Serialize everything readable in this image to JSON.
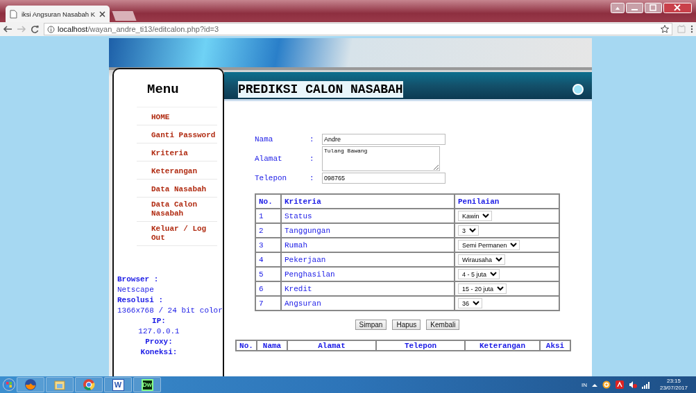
{
  "browser": {
    "tab_title": "iksi Angsuran Nasabah K",
    "url_host": "localhost",
    "url_path": "/wayan_andre_ti13/editcalon.php?id=3"
  },
  "sidebar": {
    "title": "Menu",
    "items": [
      {
        "label": "HOME"
      },
      {
        "label": "Ganti Password"
      },
      {
        "label": "Kriteria"
      },
      {
        "label": "Keterangan"
      },
      {
        "label": "Data Nasabah"
      },
      {
        "label": "Data Calon Nasabah"
      },
      {
        "label": "Keluar / Log Out"
      }
    ],
    "info": [
      {
        "kind": "label",
        "text": "Browser :"
      },
      {
        "kind": "value",
        "text": "Netscape"
      },
      {
        "kind": "label",
        "text": "Resolusi :"
      },
      {
        "kind": "value",
        "text": "1366x768 / 24 bit color"
      },
      {
        "kind": "heading",
        "text": "IP:"
      },
      {
        "kind": "detail",
        "text": "127.0.0.1"
      },
      {
        "kind": "heading",
        "text": "Proxy:"
      },
      {
        "kind": "heading",
        "text": "Koneksi:"
      }
    ]
  },
  "page": {
    "title": "PREDIKSI CALON NASABAH",
    "fields": [
      {
        "label": "Nama",
        "colon": ":",
        "kind": "input",
        "value": "Andre"
      },
      {
        "label": "Alamat",
        "colon": ":",
        "kind": "textarea",
        "value": "Tulang Bawang"
      },
      {
        "label": "Telepon",
        "colon": ":",
        "kind": "input",
        "value": "098765"
      }
    ],
    "table": {
      "columns": [
        "No.",
        "Kriteria",
        "Penilaian"
      ],
      "rows": [
        {
          "no": "1",
          "criterion": "Status",
          "rating": "Kawin"
        },
        {
          "no": "2",
          "criterion": "Tanggungan",
          "rating": "3"
        },
        {
          "no": "3",
          "criterion": "Rumah",
          "rating": "Semi Permanen"
        },
        {
          "no": "4",
          "criterion": "Pekerjaan",
          "rating": "Wirausaha"
        },
        {
          "no": "5",
          "criterion": "Penghasilan",
          "rating": "4 - 5 juta"
        },
        {
          "no": "6",
          "criterion": "Kredit",
          "rating": "15 - 20 juta"
        },
        {
          "no": "7",
          "criterion": "Angsuran",
          "rating": "36"
        }
      ]
    },
    "buttons": [
      "Simpan",
      "Hapus",
      "Kembali"
    ],
    "list_table": {
      "columns": [
        "No.",
        "Nama",
        "Alamat",
        "Telepon",
        "Keterangan",
        "Aksi"
      ]
    }
  },
  "taskbar": {
    "apps": [
      {
        "kind": "start"
      },
      {
        "kind": "fox"
      },
      {
        "kind": "folder"
      },
      {
        "kind": "chrome"
      },
      {
        "kind": "word",
        "glyph": "W"
      },
      {
        "kind": "dw",
        "glyph": "Dw"
      }
    ],
    "language": "IN",
    "time": "23:15",
    "date": "23/07/2017"
  }
}
